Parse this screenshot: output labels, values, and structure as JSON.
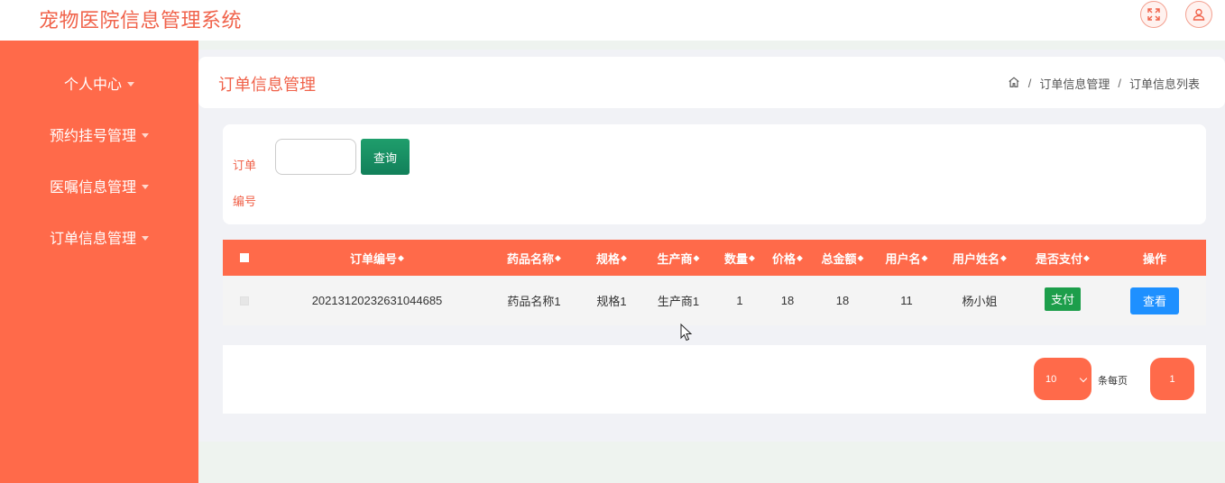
{
  "app": {
    "title": "宠物医院信息管理系统"
  },
  "topbar": {
    "fullscreen_icon": "fullscreen-icon",
    "user_icon": "user-icon"
  },
  "sidebar": {
    "items": [
      {
        "label": "个人中心"
      },
      {
        "label": "预约挂号管理"
      },
      {
        "label": "医嘱信息管理"
      },
      {
        "label": "订单信息管理"
      }
    ]
  },
  "header": {
    "title": "订单信息管理",
    "breadcrumb": [
      "订单信息管理",
      "订单信息列表"
    ],
    "home_icon": "home-icon"
  },
  "search": {
    "label": "订单编号",
    "placeholder": "",
    "value": "",
    "button_label": "查询"
  },
  "table": {
    "columns": [
      "订单编号",
      "药品名称",
      "规格",
      "生产商",
      "数量",
      "价格",
      "总金额",
      "用户名",
      "用户姓名",
      "是否支付",
      "操作"
    ],
    "sort_icon": "◆",
    "rows": [
      {
        "order_no": "20213120232631044685",
        "drug_name": "药品名称1",
        "spec": "规格1",
        "maker": "生产商1",
        "qty": "1",
        "price": "18",
        "total": "18",
        "username": "11",
        "user_fullname": "杨小姐",
        "pay_label": "支付",
        "view_label": "查看"
      }
    ]
  },
  "pagination": {
    "page_size": "10",
    "per_page_label": "条每页",
    "current_page": "1"
  },
  "colors": {
    "primary": "#ff6a4a",
    "title": "#f0624a",
    "search_button": "#1a8f62",
    "pay_button": "#1d9e4b",
    "view_button": "#1e90ff"
  }
}
